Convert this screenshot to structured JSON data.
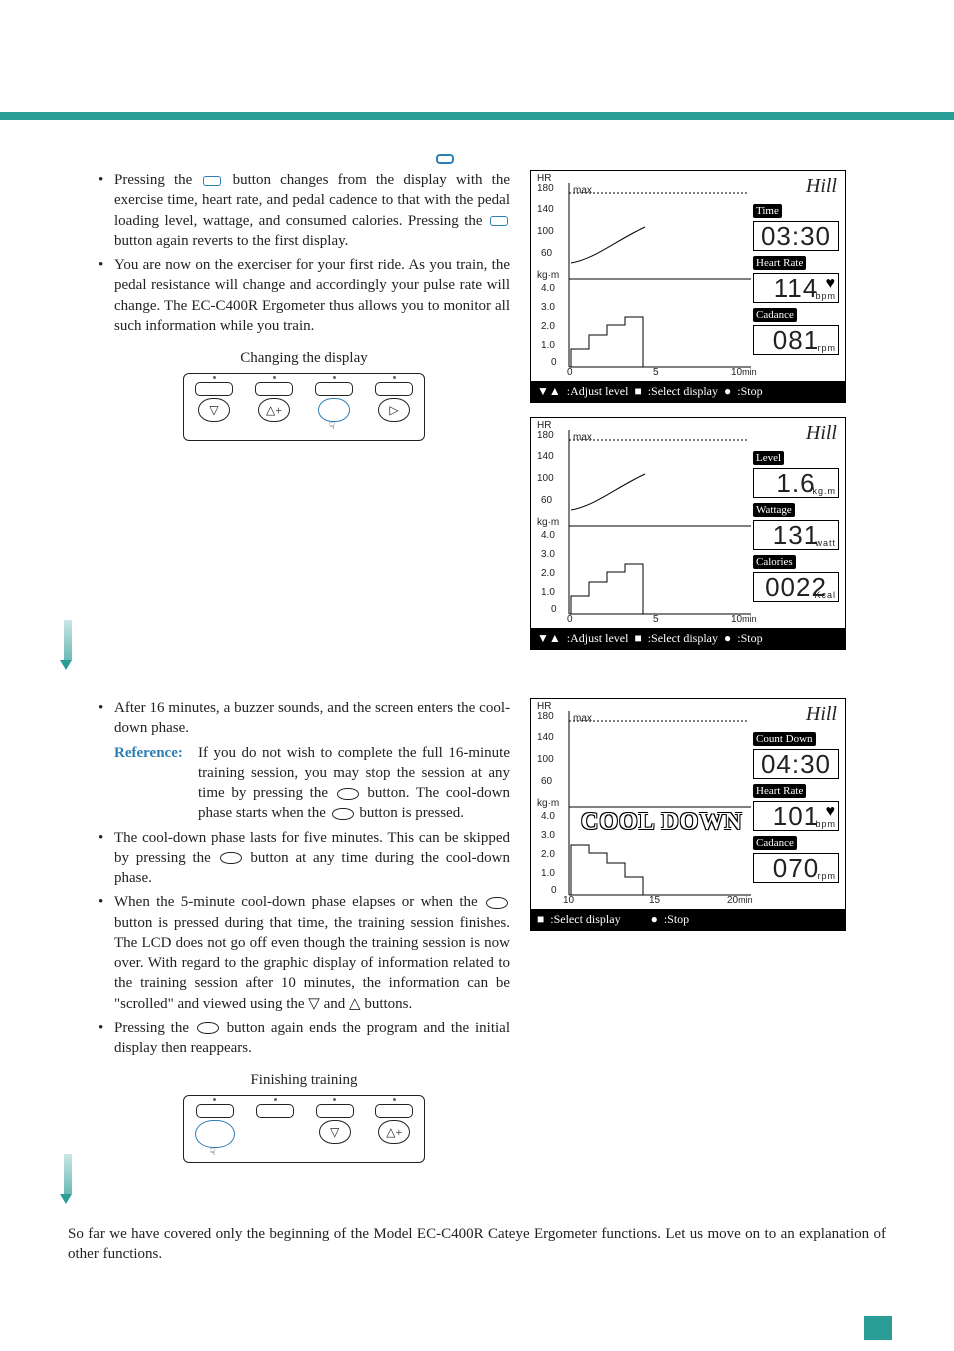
{
  "top_icon": "display-button-icon",
  "bullets_a": [
    "Pressing the [display] button changes from the display with the exercise time, heart rate, and pedal cadence to that with the pedal loading level, wattage, and consumed calories. Pressing the [display] button again reverts to the first display.",
    "You are now on the exerciser for your first ride. As you train, the pedal resistance will change and accordingly your pulse rate will change. The EC-C400R Ergometer thus allows you to monitor all such information while you train."
  ],
  "caption_a": "Changing the display",
  "bullets_b_intro": "After 16 minutes, a buzzer sounds, and the screen enters the cool-down phase.",
  "reference_label": "Reference:",
  "reference_text": "If you do not wish to complete the full 16-minute training session, you may stop the session at any time by pressing the [oval] button. The cool-down phase starts when the [oval] button is pressed.",
  "bullets_b": [
    "The cool-down phase lasts for five minutes. This can be skipped by pressing the [oval] button at any time during the cool-down phase.",
    "When the 5-minute cool-down phase elapses or when the [oval] button is pressed during that time, the training session finishes. The LCD does not go off even though the training session is now over. With regard to the graphic display of information related to the training session after 10 minutes, the information can be \"scrolled\" and viewed using the ▽ and △ buttons.",
    "Pressing the [oval] button again ends the program and the initial display then reappears."
  ],
  "caption_b": "Finishing training",
  "footer": "So far we have covered only the beginning of the Model EC-C400R Cateye Ergometer functions. Let us move on to an explanation of other functions.",
  "lcd_common": {
    "hr_label": "HR",
    "hr_ticks": [
      "180",
      "140",
      "100",
      "60"
    ],
    "max_label": "max",
    "kgm_label": "kg·m",
    "kgm_ticks": [
      "4.0",
      "3.0",
      "2.0",
      "1.0",
      "0"
    ],
    "bar_adjust": ":Adjust level",
    "bar_select": ":Select display",
    "bar_stop": ":Stop"
  },
  "lcd1": {
    "mode": "Hill",
    "x_ticks": [
      "0",
      "5",
      "10"
    ],
    "x_unit": "min",
    "stats": [
      {
        "label": "Time",
        "value": "03:30",
        "unit": ""
      },
      {
        "label": "Heart Rate",
        "value": "114",
        "unit": "bpm",
        "heart": true
      },
      {
        "label": "Cadance",
        "value": "081",
        "unit": "rpm"
      }
    ]
  },
  "lcd2": {
    "mode": "Hill",
    "x_ticks": [
      "0",
      "5",
      "10"
    ],
    "x_unit": "min",
    "stats": [
      {
        "label": "Level",
        "value": "1.6",
        "unit": "kg.m"
      },
      {
        "label": "Wattage",
        "value": "131",
        "unit": "watt"
      },
      {
        "label": "Calories",
        "value": "0022",
        "unit": "Kcal"
      }
    ]
  },
  "lcd3": {
    "mode": "Hill",
    "banner": "COOL DOWN",
    "x_ticks": [
      "10",
      "15",
      "20"
    ],
    "x_unit": "min",
    "stats": [
      {
        "label": "Count Down",
        "value": "04:30",
        "unit": ""
      },
      {
        "label": "Heart Rate",
        "value": "101",
        "unit": "bpm",
        "heart": true
      },
      {
        "label": "Cadance",
        "value": "070",
        "unit": "rpm"
      }
    ]
  }
}
